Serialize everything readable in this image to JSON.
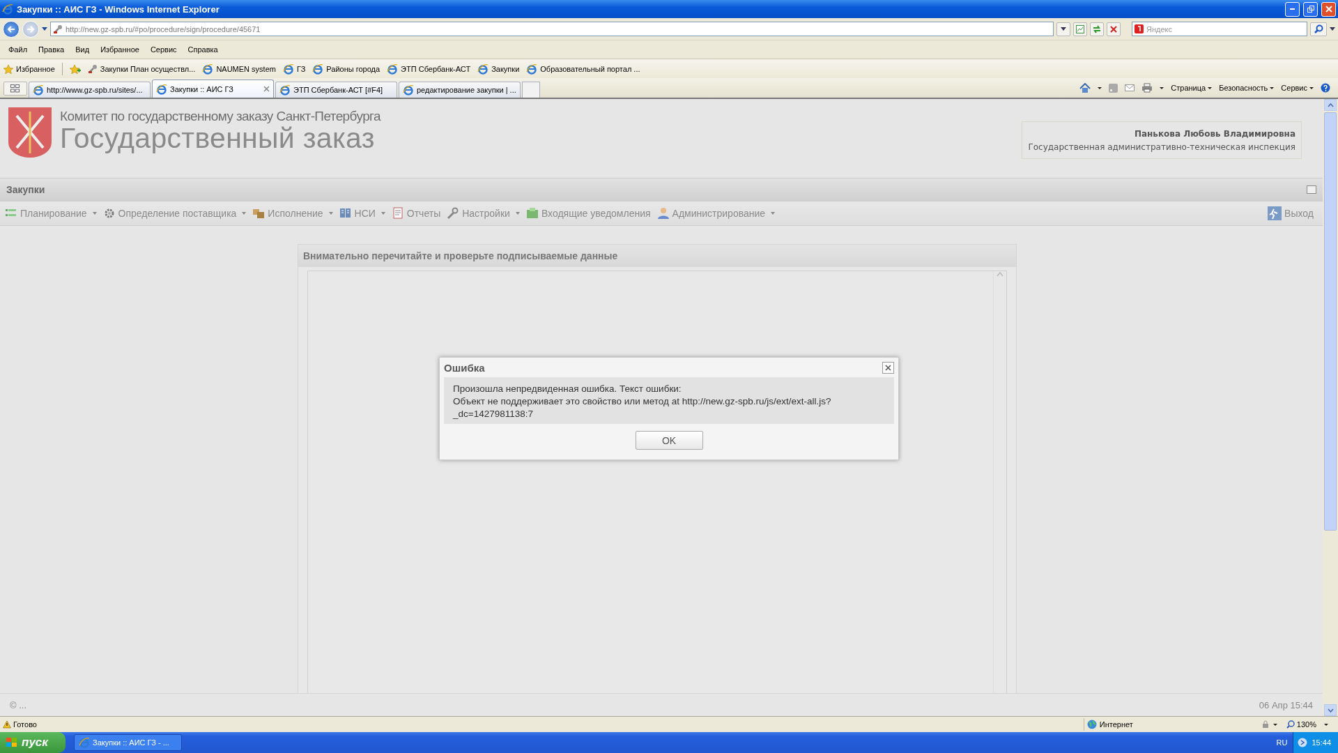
{
  "window": {
    "title": "Закупки :: АИС ГЗ - Windows Internet Explorer"
  },
  "address_bar": {
    "url": "http://new.gz-spb.ru/#po/procedure/sign/procedure/45671"
  },
  "search": {
    "placeholder": "Яндекс"
  },
  "menu": [
    "Файл",
    "Правка",
    "Вид",
    "Избранное",
    "Сервис",
    "Справка"
  ],
  "favorites": {
    "label": "Избранное",
    "items": [
      "Закупки  План осуществл...",
      "NAUMEN system",
      "ГЗ",
      "Районы города",
      "ЭТП Сбербанк-АСТ",
      "Закупки",
      "Образовательный портал ..."
    ]
  },
  "tabs": [
    {
      "label": "http://www.gz-spb.ru/sites/...",
      "selected": false
    },
    {
      "label": "Закупки :: АИС ГЗ",
      "selected": true
    },
    {
      "label": "ЭТП Сбербанк-АСТ [#F4]",
      "selected": false
    },
    {
      "label": "редактирование закупки | ...",
      "selected": false
    }
  ],
  "command_bar": [
    "Страница",
    "Безопасность",
    "Сервис"
  ],
  "header": {
    "org": "Комитет по государственному заказу Санкт-Петербурга",
    "title": "Государственный заказ"
  },
  "user": {
    "name": "Панькова Любовь Владимировна",
    "org": "Государственная административно-техническая инспекция"
  },
  "panel_title": "Закупки",
  "nav": [
    {
      "label": "Планирование",
      "has_menu": true
    },
    {
      "label": "Определение поставщика",
      "has_menu": true
    },
    {
      "label": "Исполнение",
      "has_menu": true
    },
    {
      "label": "НСИ",
      "has_menu": true
    },
    {
      "label": "Отчеты",
      "has_menu": false
    },
    {
      "label": "Настройки",
      "has_menu": true
    },
    {
      "label": "Входящие уведомления",
      "has_menu": false
    },
    {
      "label": "Администрирование",
      "has_menu": true
    }
  ],
  "logout": "Выход",
  "sign_panel": {
    "title": "Внимательно перечитайте и проверьте подписываемые данные"
  },
  "dialog": {
    "title": "Ошибка",
    "message": [
      "Произошла непредвиденная ошибка. Текст ошибки:",
      "Объект не поддерживает это свойство или метод at http://new.gz-spb.ru/js/ext/ext-all.js?_dc=1427981138:7"
    ],
    "button": "OK"
  },
  "footer": {
    "copyright": "© ...",
    "datetime": "06 Апр 15:44"
  },
  "status_bar": {
    "status": "Готово",
    "zone": "Интернет",
    "zoom": "130%"
  },
  "taskbar": {
    "start": "пуск",
    "task": "Закупки :: АИС ГЗ - ...",
    "lang": "RU",
    "clock": "15:44"
  }
}
